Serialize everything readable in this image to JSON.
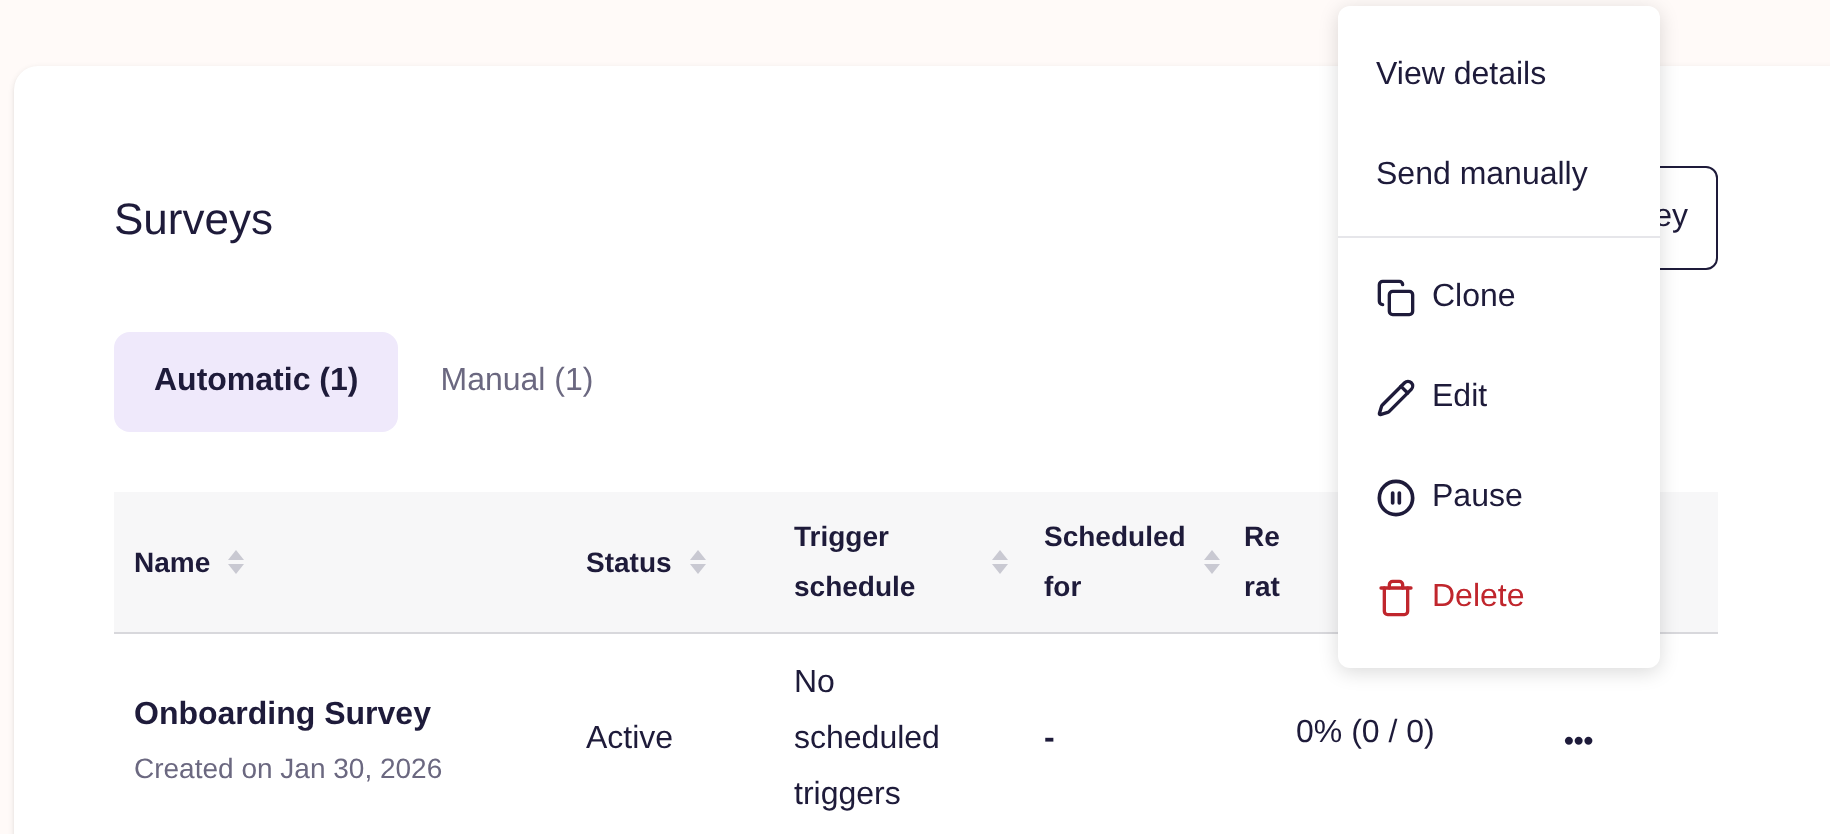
{
  "page_title": "Surveys",
  "header_button": {
    "label": "ey"
  },
  "tabs": [
    {
      "label": "Automatic (1)",
      "selected": true
    },
    {
      "label": "Manual (1)",
      "selected": false
    }
  ],
  "table": {
    "columns": [
      {
        "label": "Name",
        "sortable": true
      },
      {
        "label": "Status",
        "sortable": true
      },
      {
        "label": "Trigger schedule",
        "sortable": true
      },
      {
        "label": "Scheduled for",
        "sortable": true
      },
      {
        "label": "Re rat",
        "sortable": false
      }
    ],
    "rows": [
      {
        "name": "Onboarding Survey",
        "created": "Created on Jan 30, 2026",
        "status": "Active",
        "trigger": "No scheduled triggers",
        "scheduled_for": "-",
        "response_rate": "0% (0 / 0)",
        "actions": "•••"
      }
    ]
  },
  "menu": {
    "items": [
      {
        "label": "View details",
        "kind": "plain"
      },
      {
        "label": "Send manually",
        "kind": "plain"
      },
      {
        "kind": "divider"
      },
      {
        "label": "Clone",
        "kind": "clone"
      },
      {
        "label": "Edit",
        "kind": "edit"
      },
      {
        "label": "Pause",
        "kind": "pause"
      },
      {
        "label": "Delete",
        "kind": "delete"
      }
    ]
  }
}
